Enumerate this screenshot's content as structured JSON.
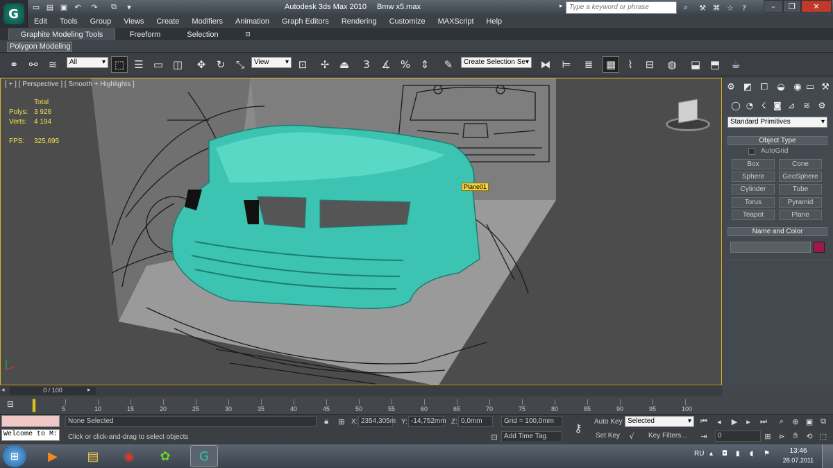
{
  "window": {
    "title": "Autodesk 3ds Max  2010",
    "file": "Bmw x5.max",
    "search_placeholder": "Type a keyword or phrase",
    "app_logo": "3ds-max-logo"
  },
  "menu": [
    "Edit",
    "Tools",
    "Group",
    "Views",
    "Create",
    "Modifiers",
    "Animation",
    "Graph Editors",
    "Rendering",
    "Customize",
    "MAXScript",
    "Help"
  ],
  "ribbon": {
    "tabs": [
      "Graphite Modeling Tools",
      "Freeform",
      "Selection"
    ],
    "panel": "Polygon Modeling"
  },
  "toolbar": {
    "filter": "All",
    "ref_coord": "View",
    "selection_set": "Create Selection Se"
  },
  "viewport": {
    "label": "[ + ] [ Perspective ] [ Smooth + Highlights ]",
    "stats": {
      "header": "Total",
      "polys_label": "Polys:",
      "polys": "3 926",
      "verts_label": "Verts:",
      "verts": "4 194",
      "fps_label": "FPS:",
      "fps": "325,695"
    },
    "object_label": "Plane01"
  },
  "command_panel": {
    "dropdown": "Standard Primitives",
    "object_type_title": "Object Type",
    "autogrid": "AutoGrid",
    "buttons": [
      "Box",
      "Cone",
      "Sphere",
      "GeoSphere",
      "Cylinder",
      "Tube",
      "Torus",
      "Pyramid",
      "Teapot",
      "Plane"
    ],
    "name_color_title": "Name and Color",
    "object_color": "#a0184a"
  },
  "timeline": {
    "position": "0 / 100",
    "ticks": [
      "5",
      "10",
      "15",
      "20",
      "25",
      "30",
      "35",
      "40",
      "45",
      "50",
      "55",
      "60",
      "65",
      "70",
      "75",
      "80",
      "85",
      "90",
      "95",
      "100"
    ]
  },
  "status": {
    "listener": "Welcome to M:",
    "selection": "None Selected",
    "prompt": "Click or click-and-drag to select objects",
    "x_label": "X:",
    "x": "2354,305m",
    "y_label": "Y:",
    "y": "-14,752mm",
    "z_label": "Z:",
    "z": "0,0mm",
    "grid": "Grid = 100,0mm",
    "add_time_tag": "Add Time Tag",
    "auto_key": "Auto Key",
    "set_key": "Set Key",
    "key_selected": "Selected",
    "key_filters": "Key Filters...",
    "frame": "0"
  },
  "taskbar": {
    "lang": "RU",
    "time": "13:46",
    "date": "28.07.2011"
  }
}
